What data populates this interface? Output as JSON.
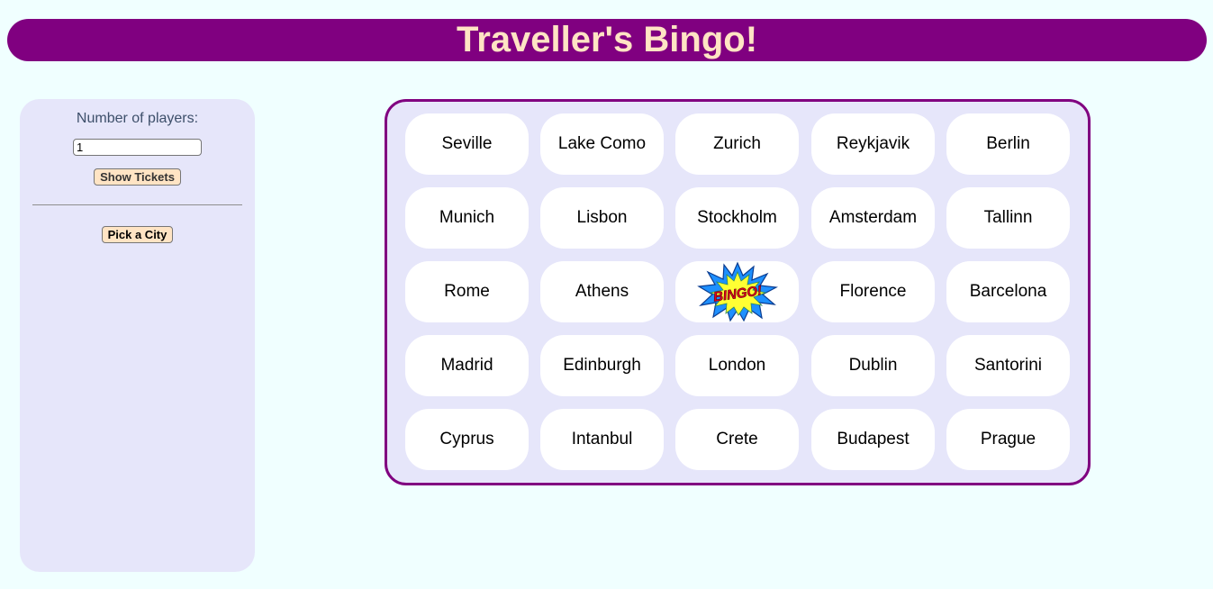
{
  "header": {
    "title": "Traveller's Bingo!"
  },
  "sidebar": {
    "players_label": "Number of players:",
    "players_value": "1",
    "show_tickets_label": "Show Tickets",
    "pick_city_label": "Pick a City"
  },
  "board": {
    "rows": [
      [
        "Seville",
        "Lake Como",
        "Zurich",
        "Reykjavik",
        "Berlin"
      ],
      [
        "Munich",
        "Lisbon",
        "Stockholm",
        "Amsterdam",
        "Tallinn"
      ],
      [
        "Rome",
        "Athens",
        "",
        "Florence",
        "Barcelona"
      ],
      [
        "Madrid",
        "Edinburgh",
        "London",
        "Dublin",
        "Santorini"
      ],
      [
        "Cyprus",
        "Intanbul",
        "Crete",
        "Budapest",
        "Prague"
      ]
    ],
    "free_cell": {
      "row": 2,
      "col": 2,
      "image_text": "BINGO!"
    }
  },
  "colors": {
    "background": "#f0ffff",
    "header": "#800080",
    "header_text": "#ffe4c4",
    "panel": "#e6e6fa",
    "cell": "#ffffff"
  }
}
